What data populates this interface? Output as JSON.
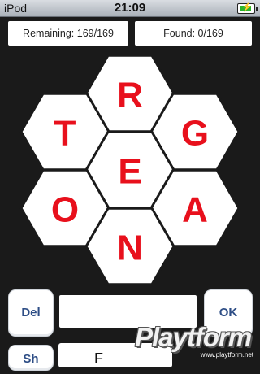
{
  "status": {
    "carrier": "iPod",
    "time": "21:09"
  },
  "counters": {
    "remaining": "Remaining: 169/169",
    "found": "Found: 0/169"
  },
  "hexes": [
    {
      "id": "top",
      "letter": "R"
    },
    {
      "id": "upper-left",
      "letter": "T"
    },
    {
      "id": "upper-right",
      "letter": "G"
    },
    {
      "id": "center",
      "letter": "E"
    },
    {
      "id": "lower-left",
      "letter": "O"
    },
    {
      "id": "lower-right",
      "letter": "A"
    },
    {
      "id": "bottom",
      "letter": "N"
    }
  ],
  "controls": {
    "del_label": "Del",
    "ok_label": "OK",
    "word_value": "",
    "bottom_left_label": "Sh",
    "bottom_word": "F"
  },
  "watermark": {
    "brand": "Playtform",
    "url": "www.playtform.net"
  },
  "colors": {
    "background": "#1a1a1a",
    "letter": "#e8101c",
    "hex_fill": "#ffffff",
    "button_text": "#2e4e86"
  }
}
